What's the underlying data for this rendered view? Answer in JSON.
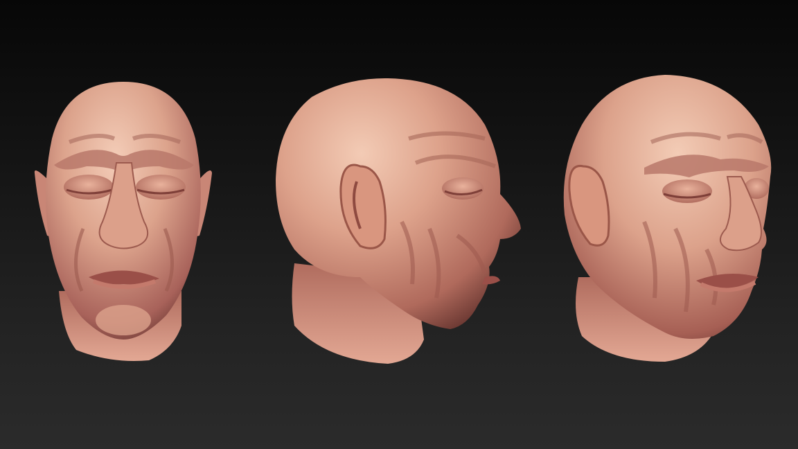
{
  "scene": {
    "background_top": "#070707",
    "background_bottom": "#2b2b2b",
    "skin_base": "#d9a08a",
    "skin_highlight": "#f2c6b0",
    "skin_shadow": "#8a4a3e",
    "views": [
      {
        "id": "front",
        "icon": "sculpt-head-front-view"
      },
      {
        "id": "profile",
        "icon": "sculpt-head-side-view"
      },
      {
        "id": "three-quarter",
        "icon": "sculpt-head-three-quarter-view"
      }
    ]
  }
}
